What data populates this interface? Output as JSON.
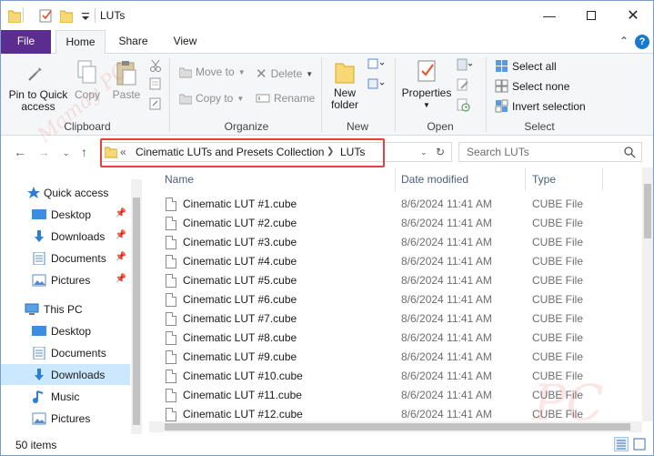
{
  "window": {
    "title": "LUTs"
  },
  "title_bar": {
    "minimize_icon": "minimize-icon",
    "maximize_icon": "maximize-icon",
    "close_icon": "close-icon"
  },
  "ribbon_tabs": {
    "file": "File",
    "home": "Home",
    "share": "Share",
    "view": "View"
  },
  "ribbon": {
    "clipboard": {
      "group_label": "Clipboard",
      "pin_label": "Pin to Quick access",
      "copy_label": "Copy",
      "paste_label": "Paste"
    },
    "organize": {
      "group_label": "Organize",
      "move_to": "Move to",
      "copy_to": "Copy to",
      "delete": "Delete",
      "rename": "Rename"
    },
    "new": {
      "group_label": "New",
      "new_folder": "New folder"
    },
    "open": {
      "group_label": "Open",
      "properties": "Properties"
    },
    "select": {
      "group_label": "Select",
      "select_all": "Select all",
      "select_none": "Select none",
      "invert_selection": "Invert selection"
    }
  },
  "address": {
    "overflow": "«",
    "crumbs": [
      "Cinematic LUTs and Presets Collection",
      "LUTs"
    ],
    "search_placeholder": "Search LUTs"
  },
  "nav_pane": {
    "quick_access": "Quick access",
    "quick_items": [
      "Desktop",
      "Downloads",
      "Documents",
      "Pictures"
    ],
    "this_pc": "This PC",
    "pc_items": [
      "Desktop",
      "Documents",
      "Downloads",
      "Music",
      "Pictures"
    ],
    "selected": "Downloads"
  },
  "file_list": {
    "columns": {
      "name": "Name",
      "date": "Date modified",
      "type": "Type"
    },
    "rows": [
      {
        "name": "Cinematic LUT #1.cube",
        "date": "8/6/2024 11:41 AM",
        "type": "CUBE File"
      },
      {
        "name": "Cinematic LUT #2.cube",
        "date": "8/6/2024 11:41 AM",
        "type": "CUBE File"
      },
      {
        "name": "Cinematic LUT #3.cube",
        "date": "8/6/2024 11:41 AM",
        "type": "CUBE File"
      },
      {
        "name": "Cinematic LUT #4.cube",
        "date": "8/6/2024 11:41 AM",
        "type": "CUBE File"
      },
      {
        "name": "Cinematic LUT #5.cube",
        "date": "8/6/2024 11:41 AM",
        "type": "CUBE File"
      },
      {
        "name": "Cinematic LUT #6.cube",
        "date": "8/6/2024 11:41 AM",
        "type": "CUBE File"
      },
      {
        "name": "Cinematic LUT #7.cube",
        "date": "8/6/2024 11:41 AM",
        "type": "CUBE File"
      },
      {
        "name": "Cinematic LUT #8.cube",
        "date": "8/6/2024 11:41 AM",
        "type": "CUBE File"
      },
      {
        "name": "Cinematic LUT #9.cube",
        "date": "8/6/2024 11:41 AM",
        "type": "CUBE File"
      },
      {
        "name": "Cinematic LUT #10.cube",
        "date": "8/6/2024 11:41 AM",
        "type": "CUBE File"
      },
      {
        "name": "Cinematic LUT #11.cube",
        "date": "8/6/2024 11:41 AM",
        "type": "CUBE File"
      },
      {
        "name": "Cinematic LUT #12.cube",
        "date": "8/6/2024 11:41 AM",
        "type": "CUBE File"
      }
    ]
  },
  "status_bar": {
    "items_count": "50 items"
  },
  "colors": {
    "file_tab": "#5c2d91",
    "selection": "#cce8ff",
    "highlight_box": "#e8413c",
    "folder": "#f8d775"
  }
}
